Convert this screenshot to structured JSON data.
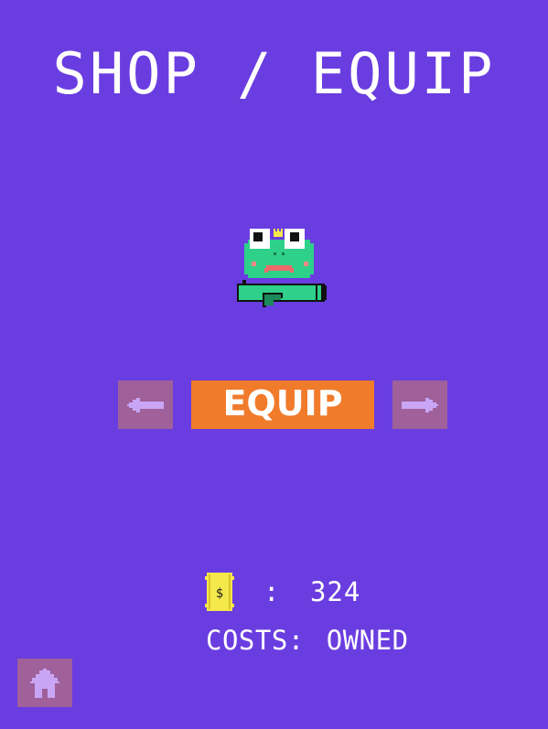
{
  "title": "SHOP / EQUIP",
  "equip_button": {
    "label": "EQUIP"
  },
  "prev_button": {
    "icon": "arrow-left-icon"
  },
  "next_button": {
    "icon": "arrow-right-icon"
  },
  "home_button": {
    "icon": "home-icon"
  },
  "currency": {
    "icon": "ticket-icon",
    "separator": ":",
    "amount": "324"
  },
  "cost": {
    "label": "COSTS:",
    "value": "OWNED"
  },
  "character": {
    "name_icon": "frog-character-icon",
    "item_icon": "bazooka-icon"
  },
  "colors": {
    "background": "#6a3de0",
    "equip_button": "#f07b2b",
    "nav_button": "#a0609a",
    "nav_arrow": "#c8a6f5",
    "frog_green": "#2ed08a",
    "ticket_yellow": "#f5e84a"
  }
}
